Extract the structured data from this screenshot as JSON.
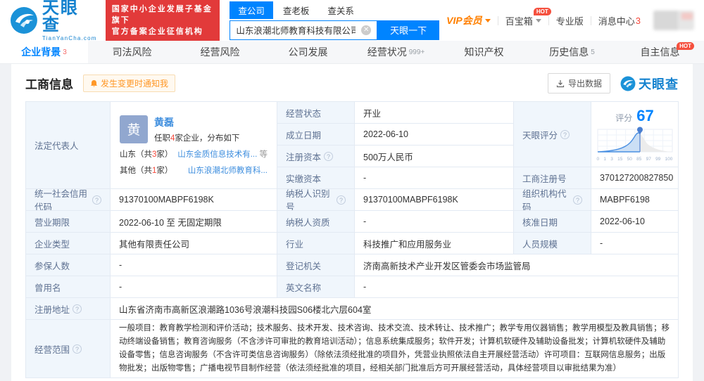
{
  "brand": {
    "name": "天眼查",
    "domain": "TianYanCha.com",
    "badge_line1": "国家中小企业发展子基金旗下",
    "badge_line2": "官方备案企业征信机构"
  },
  "search": {
    "tabs": {
      "company": "查公司",
      "boss": "查老板",
      "relation": "查关系"
    },
    "value": "山东浪潮北师教育科技有限公司",
    "button": "天眼一下"
  },
  "topmenu": {
    "vip": "VIP会员",
    "toolbox": "百宝箱",
    "toolbox_badge": "HOT",
    "pro": "专业版",
    "messages": "消息中心",
    "message_count": "3"
  },
  "tabs": {
    "t1": {
      "label": "企业背景",
      "count": "3"
    },
    "t2": {
      "label": "司法风险"
    },
    "t3": {
      "label": "经营风险"
    },
    "t4": {
      "label": "公司发展"
    },
    "t5": {
      "label": "经营状况",
      "count": "999+"
    },
    "t6": {
      "label": "知识产权"
    },
    "t7": {
      "label": "历史信息",
      "count": "5"
    },
    "t8": {
      "label": "自主信息",
      "badge": "HOT"
    }
  },
  "section": {
    "title": "工商信息",
    "notify": "发生变更时通知我",
    "export": "导出数据",
    "watermark": "天眼查"
  },
  "legal_rep": {
    "label": "法定代表人",
    "avatar": "黄",
    "name": "黄磊",
    "tenure_pre": "任职",
    "tenure_num": "4",
    "tenure_post": "家企业，分布如下",
    "row1_region_pre": "山东（共",
    "row1_region_num": "3",
    "row1_region_post": "家）",
    "row1_company": "山东金质信息技术有...",
    "row1_extra": "等",
    "row2_region_pre": "其他（共",
    "row2_region_num": "1",
    "row2_region_post": "家）",
    "row2_company": "山东浪潮北师教育科..."
  },
  "score": {
    "label": "天眼评分",
    "prefix": "评分",
    "value": "67",
    "ticks": [
      "0",
      "1",
      "3",
      "15",
      "50",
      "85",
      "97",
      "99",
      "100"
    ]
  },
  "fields": {
    "status": {
      "label": "经营状态",
      "value": "开业"
    },
    "est_date": {
      "label": "成立日期",
      "value": "2022-06-10"
    },
    "reg_capital": {
      "label": "注册资本",
      "value": "500万人民币"
    },
    "paid_capital": {
      "label": "实缴资本",
      "value": "-"
    },
    "reg_no": {
      "label": "工商注册号",
      "value": "370127200827850"
    },
    "credit_code": {
      "label": "统一社会信用代码",
      "value": "91370100MABPF6198K"
    },
    "tax_id": {
      "label": "纳税人识别号",
      "value": "91370100MABPF6198K"
    },
    "org_code": {
      "label": "组织机构代码",
      "value": "MABPF6198"
    },
    "term": {
      "label": "营业期限",
      "value": "2022-06-10 至 无固定期限"
    },
    "tax_quality": {
      "label": "纳税人资质",
      "value": "-"
    },
    "approve_date": {
      "label": "核准日期",
      "value": "2022-06-10"
    },
    "ent_type": {
      "label": "企业类型",
      "value": "其他有限责任公司"
    },
    "industry": {
      "label": "行业",
      "value": "科技推广和应用服务业"
    },
    "staff": {
      "label": "人员规模",
      "value": "-"
    },
    "insured": {
      "label": "参保人数",
      "value": "-"
    },
    "registry": {
      "label": "登记机关",
      "value": "济南高新技术产业开发区管委会市场监管局"
    },
    "former_name": {
      "label": "曾用名",
      "value": "-"
    },
    "en_name": {
      "label": "英文名称",
      "value": "-"
    },
    "address": {
      "label": "注册地址",
      "value": "山东省济南市高新区浪潮路1036号浪潮科技园S06楼北六层604室"
    },
    "scope": {
      "label": "经营范围",
      "value": "一般项目：教育教学检测和评价活动；技术服务、技术开发、技术咨询、技术交流、技术转让、技术推广；教学专用仪器销售；教学用模型及教具销售；移动终端设备销售；教育咨询服务（不含涉许可审批的教育培训活动）；信息系统集成服务；软件开发；计算机软硬件及辅助设备批发；计算机软硬件及辅助设备零售；信息咨询服务（不含许可类信息咨询服务）（除依法须经批准的项目外，凭营业执照依法自主开展经营活动）许可项目：互联网信息服务；出版物批发；出版物零售；广播电视节目制作经营（依法须经批准的项目，经相关部门批准后方可开展经营活动，具体经营项目以审批结果为准）"
    }
  }
}
